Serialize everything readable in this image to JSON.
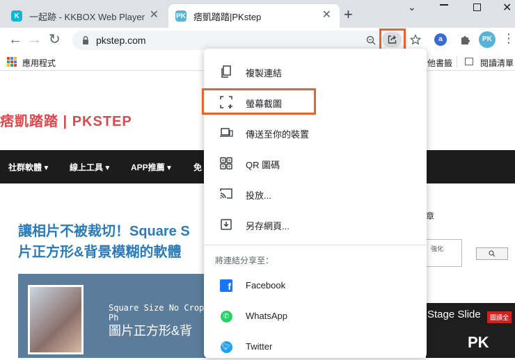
{
  "browser": {
    "tabs": [
      {
        "title": "一起跡 - KKBOX Web Player",
        "favicon": "K",
        "favicon_color": "#09b8d6",
        "active": false
      },
      {
        "title": "痞凱踏踏|PKstep",
        "favicon": "PK",
        "favicon_color": "#56b4d8",
        "active": true
      }
    ],
    "new_tab_label": "+",
    "url": "pkstep.com",
    "profile_initials": "PK"
  },
  "bookmarks": {
    "apps_label": "應用程式",
    "item1": "他書籤",
    "item2": "閱讀清單"
  },
  "page": {
    "site_title": "痞凱踏踏 | PKSTEP",
    "nav": [
      "社群軟體 ▾",
      "線上工具 ▾",
      "APP推薦 ▾",
      "免"
    ],
    "article_title_line1": "讓相片不被裁切！Square S",
    "article_title_line2": "片正方形&背景模糊的軟體",
    "hero_text1": "Square Size No Crop Ph",
    "hero_text2": "圖片正方形&背",
    "sidebar_label": "章",
    "sidebar_input": "強化",
    "sidebar_button": "",
    "right_caption": "Stage Slide",
    "right_badge": "圖讀全",
    "right_logo": "PK"
  },
  "share_menu": {
    "items": [
      {
        "label": "複製連結",
        "icon": "copy-icon"
      },
      {
        "label": "螢幕截圖",
        "icon": "screenshot-icon"
      },
      {
        "label": "傳送至你的裝置",
        "icon": "devices-icon"
      },
      {
        "label": "QR 圖碼",
        "icon": "qr-code-icon"
      },
      {
        "label": "投放...",
        "icon": "cast-icon"
      },
      {
        "label": "另存網頁...",
        "icon": "save-page-icon"
      }
    ],
    "share_to_label": "將連結分享至：",
    "social": [
      {
        "label": "Facebook",
        "icon": "facebook-icon",
        "color": "#1877f2"
      },
      {
        "label": "WhatsApp",
        "icon": "whatsapp-icon",
        "color": "#25d366"
      },
      {
        "label": "Twitter",
        "icon": "twitter-icon",
        "color": "#1da1f2"
      }
    ]
  },
  "colors": {
    "highlight": "#e8622c",
    "site_red": "#e0474c",
    "title_blue": "#2b7bb9"
  }
}
